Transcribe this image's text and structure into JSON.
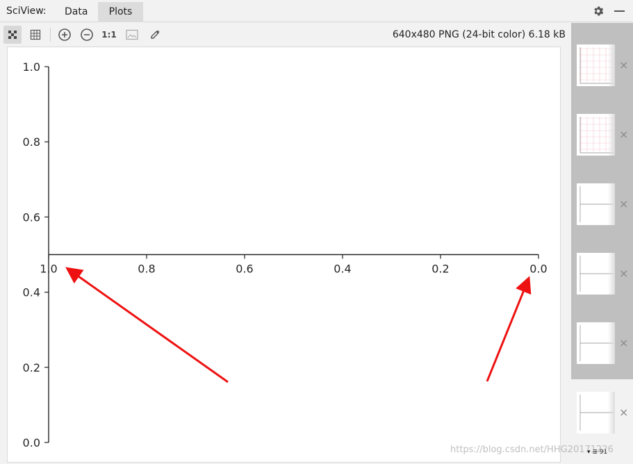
{
  "topbar": {
    "app_label": "SciView:",
    "tabs": [
      {
        "label": "Data",
        "active": false
      },
      {
        "label": "Plots",
        "active": true
      }
    ],
    "icons": [
      "gear-icon",
      "minimize-icon"
    ]
  },
  "toolbar": {
    "buttons": [
      "fit-zoom-icon",
      "grid-icon",
      "zoom-in-icon",
      "zoom-out-icon",
      "actual-size-icon",
      "image-icon",
      "color-picker-icon"
    ],
    "actual_size_label": "1:1",
    "image_info": "640x480 PNG (24-bit color) 6.18 kB"
  },
  "chart_data": {
    "type": "line",
    "title": "",
    "xlabel": "",
    "ylabel": "",
    "x_tick_labels": [
      "1.0",
      "0.8",
      "0.6",
      "0.4",
      "0.2",
      "0.0"
    ],
    "y_tick_labels": [
      "1.0",
      "0.8",
      "0.6",
      "0.4",
      "0.2",
      "0.0"
    ],
    "xlim": [
      1.0,
      0.0
    ],
    "ylim": [
      0.0,
      1.0
    ],
    "x_axis_crosses_y_at": 0.5,
    "x_axis_inverted": true,
    "series": [],
    "grid": false,
    "annotations": [
      {
        "type": "arrow",
        "color": "#ee1111",
        "points_to": "x tick 1.0"
      },
      {
        "type": "arrow",
        "color": "#ee1111",
        "points_to": "x tick 0.0"
      }
    ]
  },
  "thumbnails": {
    "items": [
      {
        "id": "plot-1",
        "selected": false
      },
      {
        "id": "plot-2",
        "selected": false
      },
      {
        "id": "plot-3",
        "selected": false
      },
      {
        "id": "plot-4",
        "selected": false
      },
      {
        "id": "plot-5",
        "selected": false
      },
      {
        "id": "plot-6",
        "selected": true
      }
    ],
    "close_glyph": "×",
    "pager_label": "▾ ≣ 91"
  },
  "watermark": "https://blog.csdn.net/HHG20171226"
}
